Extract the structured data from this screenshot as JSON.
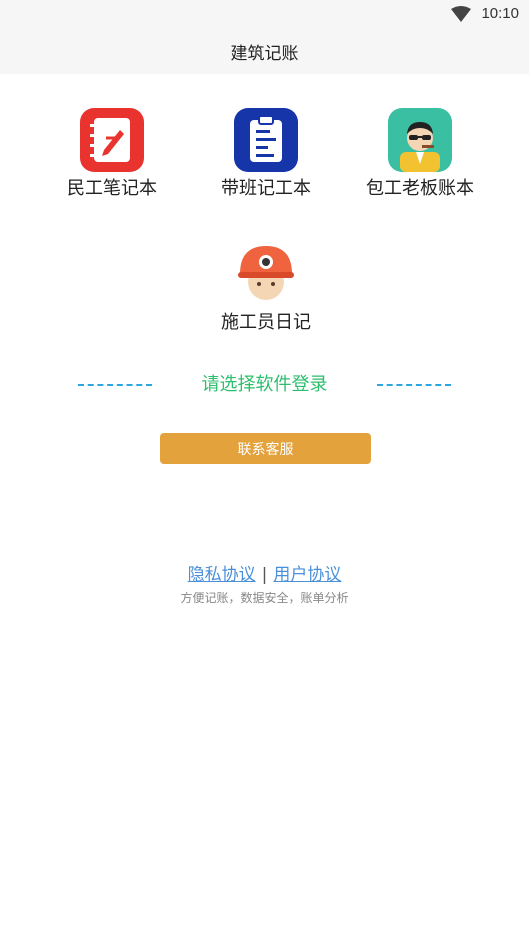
{
  "status_bar": {
    "time": "10:10",
    "wifi_icon": "wifi-icon"
  },
  "header": {
    "title": "建筑记账"
  },
  "apps": [
    {
      "label": "民工笔记本",
      "icon": "notebook-pen-icon",
      "color": "#e8332e"
    },
    {
      "label": "带班记工本",
      "icon": "clipboard-icon",
      "color": "#1535a8"
    },
    {
      "label": "包工老板账本",
      "icon": "boss-avatar-icon",
      "color": "#3bbfa3"
    },
    {
      "label": "施工员日记",
      "icon": "worker-helmet-icon",
      "color": "#f0633f"
    }
  ],
  "login_prompt": "请选择软件登录",
  "contact_button": "联系客服",
  "links": {
    "privacy": "隐私协议",
    "separator": "|",
    "user": "用户协议"
  },
  "tagline": "方便记账，数据安全，账单分析",
  "colors": {
    "accent_green": "#2cbf6c",
    "button_orange": "#e3a23c",
    "link_blue": "#4a90d9",
    "dash_blue": "#2aa7e0"
  }
}
